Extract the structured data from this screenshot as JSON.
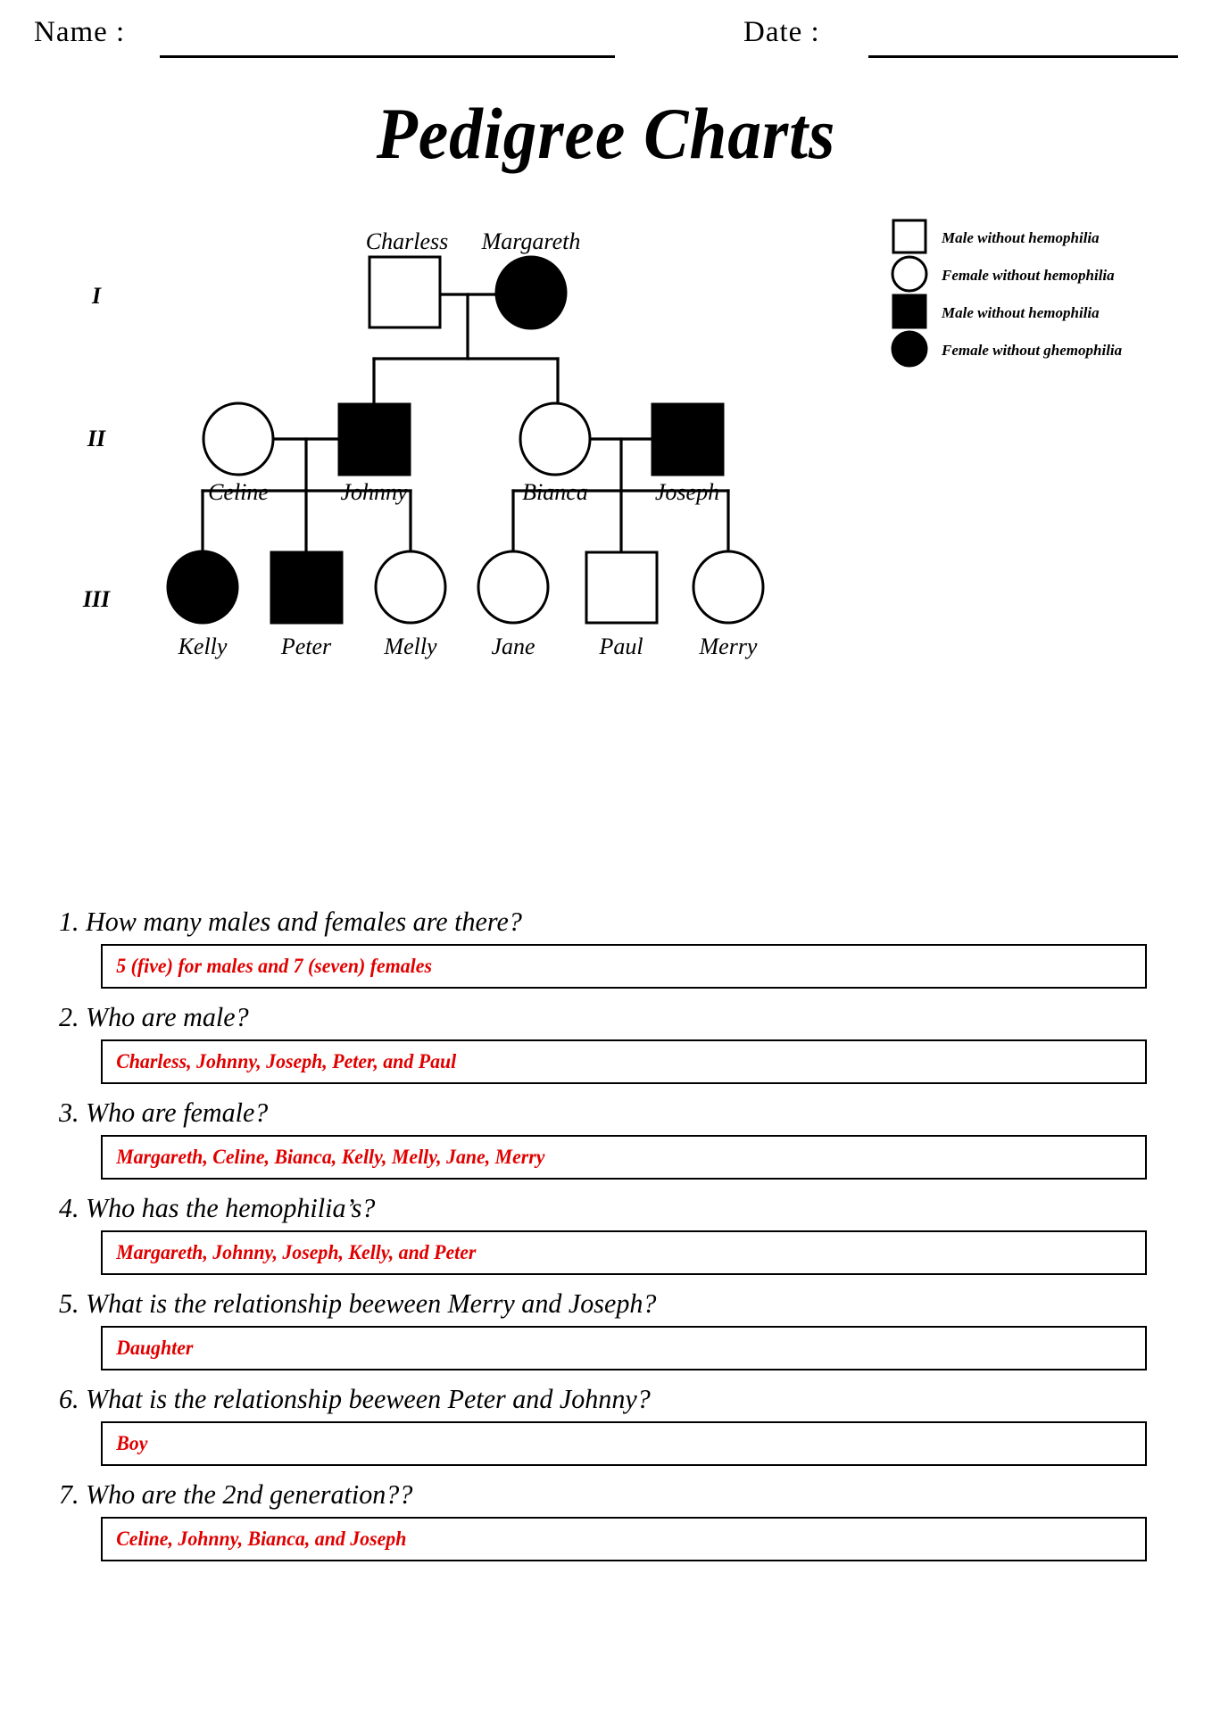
{
  "header": {
    "name_label": "Name :",
    "date_label": "Date  :",
    "name_value": "",
    "date_value": ""
  },
  "title": "Pedigree Charts",
  "pedigree": {
    "generation_labels": [
      "I",
      "II",
      "III"
    ],
    "legend": [
      {
        "symbol": "open-square",
        "label": "Male without hemophilia"
      },
      {
        "symbol": "open-circle",
        "label": "Female without hemophilia"
      },
      {
        "symbol": "filled-square",
        "label": "Male without hemophilia"
      },
      {
        "symbol": "filled-circle",
        "label": "Female without ghemophilia"
      }
    ],
    "people": [
      {
        "name": "Charless",
        "sex": "male",
        "affected": false,
        "generation": "I"
      },
      {
        "name": "Margareth",
        "sex": "female",
        "affected": true,
        "generation": "I"
      },
      {
        "name": "Celine",
        "sex": "female",
        "affected": false,
        "generation": "II"
      },
      {
        "name": "Johnny",
        "sex": "male",
        "affected": true,
        "generation": "II"
      },
      {
        "name": "Bianca",
        "sex": "female",
        "affected": false,
        "generation": "II"
      },
      {
        "name": "Joseph",
        "sex": "male",
        "affected": true,
        "generation": "II"
      },
      {
        "name": "Kelly",
        "sex": "female",
        "affected": true,
        "generation": "III"
      },
      {
        "name": "Peter",
        "sex": "male",
        "affected": true,
        "generation": "III"
      },
      {
        "name": "Melly",
        "sex": "female",
        "affected": false,
        "generation": "III"
      },
      {
        "name": "Jane",
        "sex": "female",
        "affected": false,
        "generation": "III"
      },
      {
        "name": "Paul",
        "sex": "male",
        "affected": false,
        "generation": "III"
      },
      {
        "name": "Merry",
        "sex": "female",
        "affected": false,
        "generation": "III"
      }
    ]
  },
  "questions": [
    {
      "number": "1.",
      "text": "1. How many males and females are there?",
      "answer": "5 (five) for males and 7 (seven) females"
    },
    {
      "number": "2.",
      "text": "2. Who are male?",
      "answer": "Charless, Johnny, Joseph, Peter, and Paul"
    },
    {
      "number": "3.",
      "text": "3. Who are female?",
      "answer": "Margareth, Celine, Bianca, Kelly, Melly, Jane, Merry"
    },
    {
      "number": "4.",
      "text": "4. Who has the hemophilia’s?",
      "answer": "Margareth, Johnny, Joseph, Kelly, and Peter"
    },
    {
      "number": "5.",
      "text": "5. What is the relationship beeween Merry and Joseph?",
      "answer": "Daughter"
    },
    {
      "number": "6.",
      "text": "6. What is the relationship beeween Peter and Johnny?",
      "answer": "Boy"
    },
    {
      "number": "7.",
      "text": "7. Who are the 2nd generation??",
      "answer": "Celine, Johnny, Bianca, and Joseph"
    }
  ],
  "colors": {
    "answer_text": "#e00000",
    "ink": "#000000",
    "page": "#ffffff"
  }
}
